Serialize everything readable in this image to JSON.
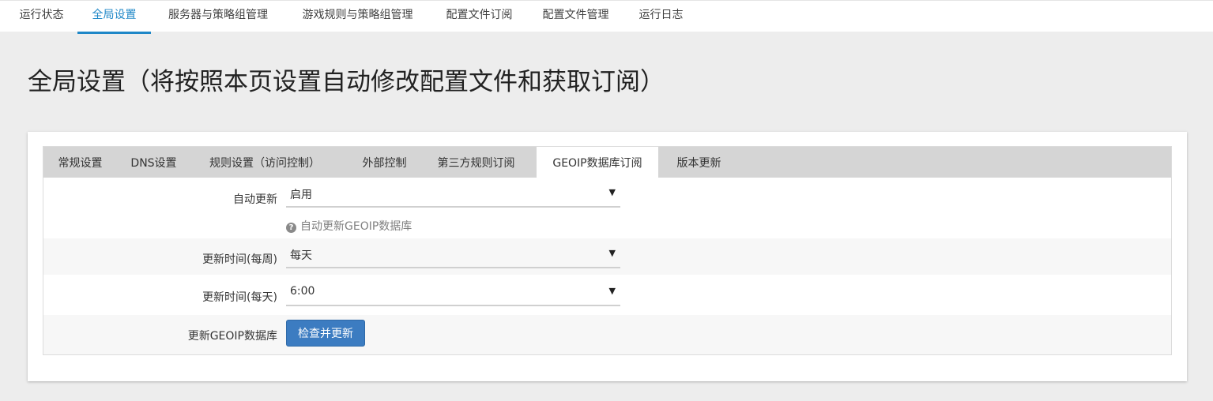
{
  "topnav": {
    "items": [
      "运行状态",
      "全局设置",
      "服务器与策略组管理",
      "游戏规则与策略组管理",
      "配置文件订阅",
      "配置文件管理",
      "运行日志"
    ],
    "active_index": 1
  },
  "page": {
    "title": "全局设置（将按照本页设置自动修改配置文件和获取订阅）"
  },
  "tabs": {
    "items": [
      "常规设置",
      "DNS设置",
      "规则设置（访问控制）",
      "外部控制",
      "第三方规则订阅",
      "GEOIP数据库订阅",
      "版本更新"
    ],
    "active_index": 5
  },
  "form": {
    "auto_update": {
      "label": "自动更新",
      "value": "启用",
      "help": "自动更新GEOIP数据库"
    },
    "update_week": {
      "label": "更新时间(每周)",
      "value": "每天"
    },
    "update_day": {
      "label": "更新时间(每天)",
      "value": "6:00"
    },
    "update_db": {
      "label": "更新GEOIP数据库",
      "button": "检查并更新"
    }
  },
  "icons": {
    "dropdown": "chevron-down-icon",
    "help": "question-circle-icon"
  },
  "colors": {
    "accent": "#1e87c7",
    "button": "#3c7cc1",
    "tabbar": "#d5d5d5",
    "background": "#ededed"
  }
}
